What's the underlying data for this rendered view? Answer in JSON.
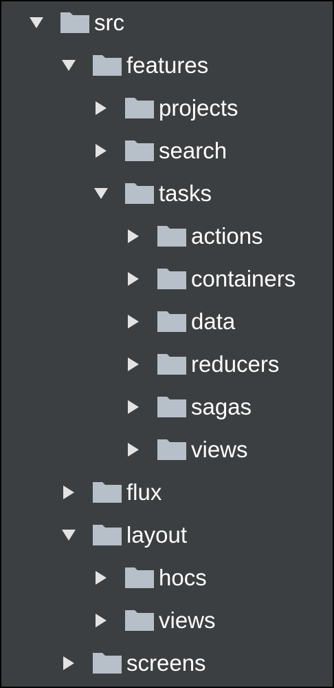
{
  "colors": {
    "background": "#3c3f41",
    "border": "#000000",
    "text": "#ffffff",
    "arrow": "#e3e3e3",
    "folder": "#b7c0c8"
  },
  "icons": {
    "expanded": "triangle-down-icon",
    "collapsed": "triangle-right-icon",
    "folder": "folder-icon"
  },
  "tree": [
    {
      "id": "src",
      "label": "src",
      "depth": 0,
      "expanded": true
    },
    {
      "id": "features",
      "label": "features",
      "depth": 1,
      "expanded": true
    },
    {
      "id": "projects",
      "label": "projects",
      "depth": 2,
      "expanded": false
    },
    {
      "id": "search",
      "label": "search",
      "depth": 2,
      "expanded": false
    },
    {
      "id": "tasks",
      "label": "tasks",
      "depth": 2,
      "expanded": true
    },
    {
      "id": "actions",
      "label": "actions",
      "depth": 3,
      "expanded": false
    },
    {
      "id": "containers",
      "label": "containers",
      "depth": 3,
      "expanded": false
    },
    {
      "id": "data",
      "label": "data",
      "depth": 3,
      "expanded": false
    },
    {
      "id": "reducers",
      "label": "reducers",
      "depth": 3,
      "expanded": false
    },
    {
      "id": "sagas",
      "label": "sagas",
      "depth": 3,
      "expanded": false
    },
    {
      "id": "views",
      "label": "views",
      "depth": 3,
      "expanded": false
    },
    {
      "id": "flux",
      "label": "flux",
      "depth": 1,
      "expanded": false
    },
    {
      "id": "layout",
      "label": "layout",
      "depth": 1,
      "expanded": true
    },
    {
      "id": "hocs",
      "label": "hocs",
      "depth": 2,
      "expanded": false
    },
    {
      "id": "layout-views",
      "label": "views",
      "depth": 2,
      "expanded": false
    },
    {
      "id": "screens",
      "label": "screens",
      "depth": 1,
      "expanded": false
    }
  ]
}
